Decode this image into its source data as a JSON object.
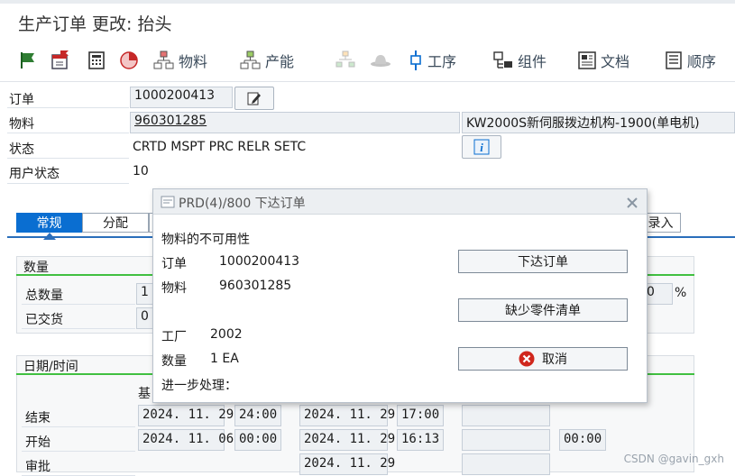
{
  "window": {
    "title": "生产订单 更改: 抬头"
  },
  "toolbar": {
    "material_label": "物料",
    "capacity_label": "产能",
    "operation_label": "工序",
    "component_label": "组件",
    "document_label": "文档",
    "sequence_label": "顺序"
  },
  "header": {
    "order_label": "订单",
    "order_value": "1000200413",
    "material_label": "物料",
    "material_value": "960301285",
    "material_desc": "KW2000S新伺服拨边机构-1900(单电机)",
    "status_label": "状态",
    "status_value": "CRTD MSPT PRC  RELR SETC",
    "user_status_label": "用户状态",
    "user_status_value": "10"
  },
  "tabs": {
    "general": "常规",
    "assignment": "分配",
    "entry_partial": "录入"
  },
  "quantity_group": {
    "title": "数量",
    "total_label": "总数量",
    "total_value": "1",
    "delivered_label": "已交货",
    "delivered_value": "0",
    "pct_value": "0",
    "pct_unit": "%"
  },
  "date_group": {
    "title": "日期/时间",
    "basic_col_partial": "基",
    "end_label": "结束",
    "start_label": "开始",
    "release_label": "审批",
    "basic_end_date": "2024. 11. 29",
    "basic_end_time": "24:00",
    "basic_start_date": "2024. 11. 06",
    "basic_start_time": "00:00",
    "sched_end_date": "2024. 11. 29",
    "sched_end_time": "17:00",
    "sched_start_date": "2024. 11. 29",
    "sched_start_time": "16:13",
    "sched_release_date": "2024. 11. 29",
    "actual_start_time": "00:00"
  },
  "dialog": {
    "title": "PRD(4)/800 下达订单",
    "message": "物料的不可用性",
    "order_label": "订单",
    "order_value": "1000200413",
    "material_label": "物料",
    "material_value": "960301285",
    "plant_label": "工厂",
    "plant_value": "2002",
    "qty_label": "数量",
    "qty_value": "1 EA",
    "further_label": "进一步处理：",
    "release_button": "下达订单",
    "missing_parts_button": "缺少零件清单",
    "cancel_button": "取消"
  },
  "watermark": "CSDN @gavin_gxh",
  "colors": {
    "accent": "#0a6ed1",
    "group_line": "#41c041",
    "cancel_red": "#d0271d"
  }
}
